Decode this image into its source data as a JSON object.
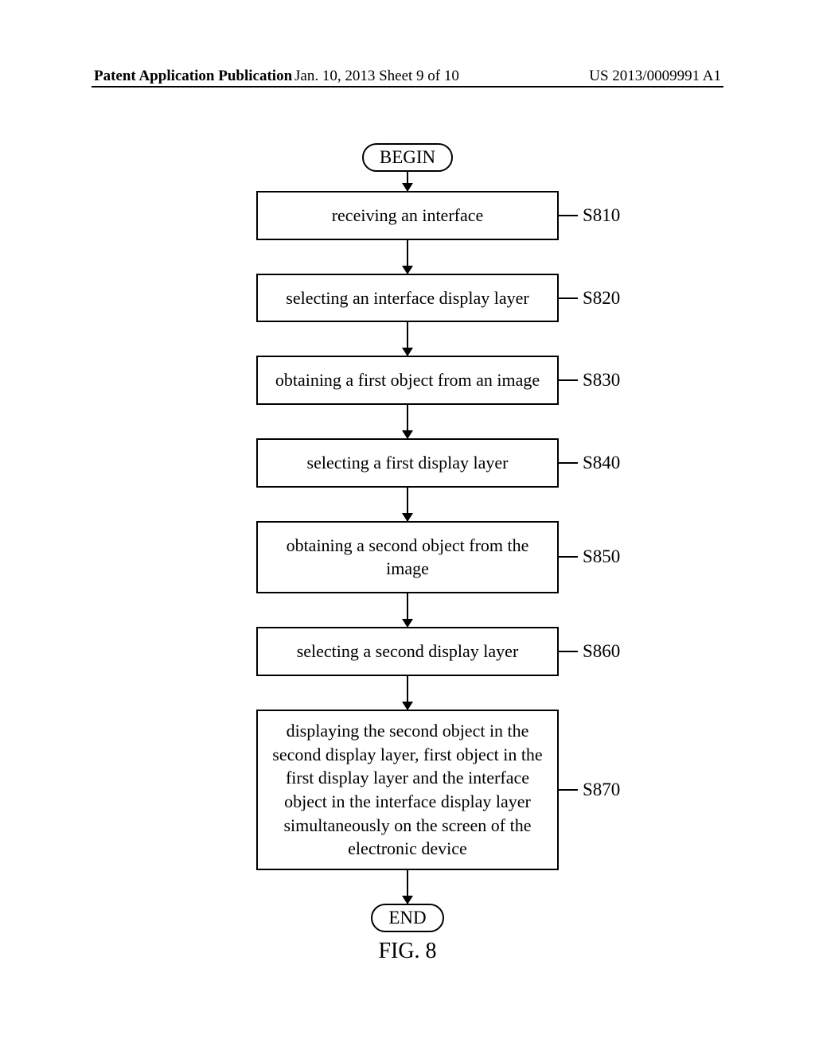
{
  "header": {
    "left": "Patent Application Publication",
    "center": "Jan. 10, 2013  Sheet 9 of 10",
    "right": "US 2013/0009991 A1"
  },
  "flowchart": {
    "begin": "BEGIN",
    "end": "END",
    "figure_label": "FIG. 8",
    "steps": [
      {
        "text": "receiving an interface",
        "label": "S810"
      },
      {
        "text": "selecting an interface display layer",
        "label": "S820"
      },
      {
        "text": "obtaining a first object from an image",
        "label": "S830"
      },
      {
        "text": "selecting a first display layer",
        "label": "S840"
      },
      {
        "text": "obtaining a second object from the image",
        "label": "S850"
      },
      {
        "text": "selecting a second display layer",
        "label": "S860"
      },
      {
        "text": "displaying the second object in the second display layer, first object in the first display layer and the interface object in the interface display layer simultaneously on the screen of the electronic device",
        "label": "S870"
      }
    ]
  }
}
